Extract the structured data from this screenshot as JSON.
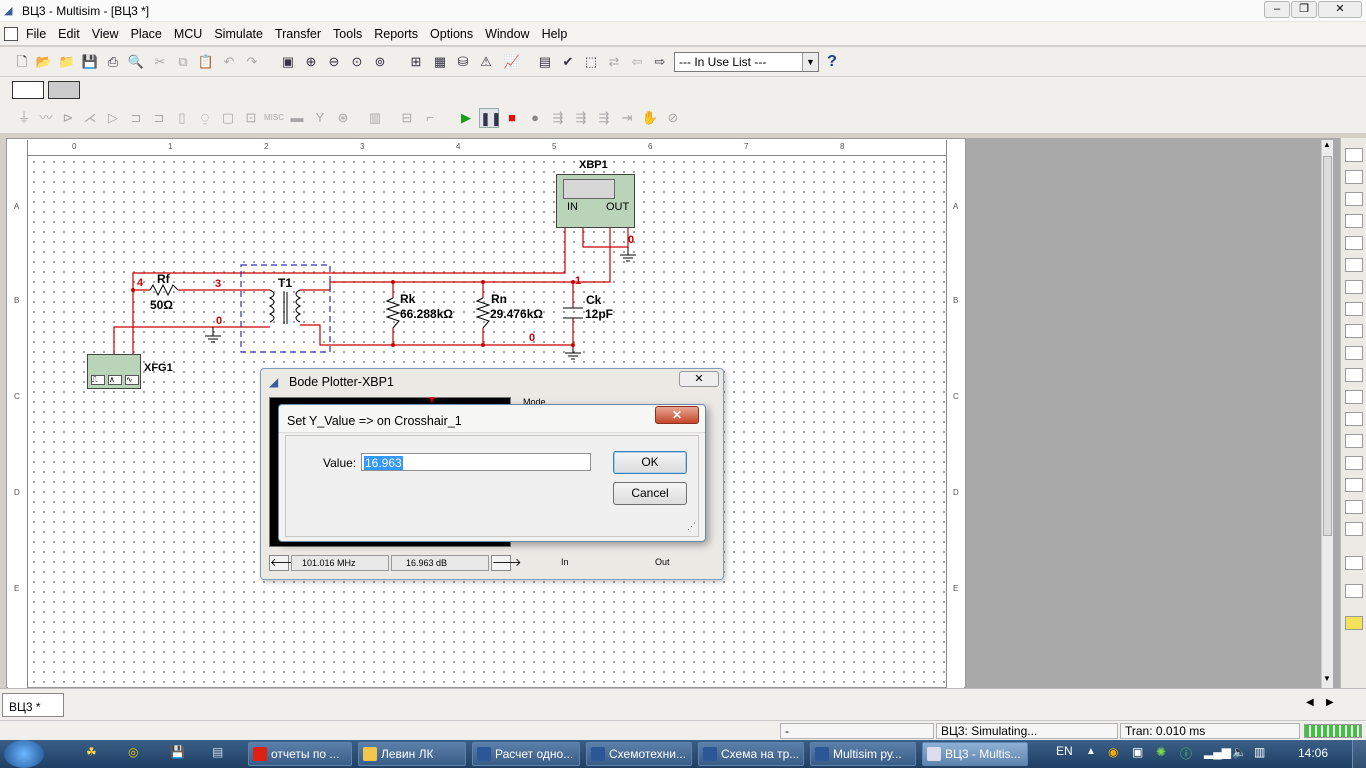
{
  "window": {
    "title": "ВЦ3 - Multisim - [ВЦ3 *]"
  },
  "menu": [
    "File",
    "Edit",
    "View",
    "Place",
    "MCU",
    "Simulate",
    "Transfer",
    "Tools",
    "Reports",
    "Options",
    "Window",
    "Help"
  ],
  "toolbar": {
    "in_use_list": "--- In Use List ---",
    "help": "?"
  },
  "ruler": {
    "top": [
      "0",
      "1",
      "2",
      "3",
      "4",
      "5",
      "6",
      "7",
      "8"
    ],
    "left": [
      "A",
      "B",
      "C",
      "D",
      "E"
    ]
  },
  "circuit": {
    "components": {
      "rf": {
        "ref": "Rf",
        "value": "50Ω"
      },
      "t1": {
        "ref": "T1"
      },
      "rk": {
        "ref": "Rk",
        "value": "66.288kΩ"
      },
      "rn": {
        "ref": "Rn",
        "value": "29.476kΩ"
      },
      "ck": {
        "ref": "Ck",
        "value": "12pF"
      },
      "xfg1": {
        "ref": "XFG1"
      },
      "xbp1": {
        "ref": "XBP1",
        "in": "IN",
        "out": "OUT"
      }
    },
    "nets": {
      "n4": "4",
      "n3": "3",
      "n0a": "0",
      "n0b": "0",
      "n1": "1",
      "n0c": "0"
    }
  },
  "bode": {
    "title": "Bode Plotter-XBP1",
    "mode_label": "Mode",
    "freq_readout": "101.016 MHz",
    "db_readout": "16.963 dB",
    "in_label": "In",
    "out_label": "Out"
  },
  "dialog": {
    "title": "Set Y_Value => on Crosshair_1",
    "value_label": "Value:",
    "value": "16.963",
    "ok": "OK",
    "cancel": "Cancel"
  },
  "tabs": [
    "ВЦ3 *"
  ],
  "status": {
    "cell1": "-",
    "cell2": "ВЦ3: Simulating...",
    "cell3": "Tran: 0.010 ms"
  },
  "taskbar": {
    "items": [
      "отчеты по ...",
      "Левин ЛК",
      "Расчет одно...",
      "Схемотехни...",
      "Схема на тр...",
      "Multisim ру...",
      "ВЦ3 - Multis..."
    ],
    "lang": "EN",
    "clock": "14:06"
  },
  "colors": {
    "wire": "#cc0000",
    "instrument": "#b9d4b9",
    "selection": "#3030c0"
  }
}
